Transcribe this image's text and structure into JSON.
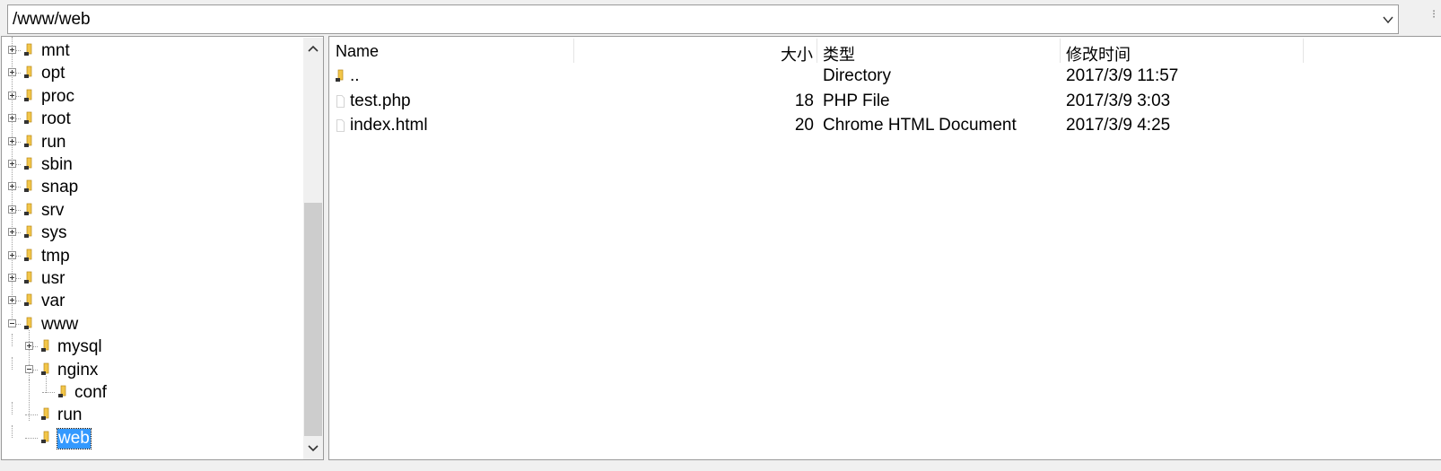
{
  "path_bar": {
    "value": "/www/web",
    "dropdown_icon": "chevron-down-icon"
  },
  "tree": {
    "items": [
      {
        "label": "mnt",
        "level": 0,
        "toggle": "plus"
      },
      {
        "label": "opt",
        "level": 0,
        "toggle": "plus"
      },
      {
        "label": "proc",
        "level": 0,
        "toggle": "plus"
      },
      {
        "label": "root",
        "level": 0,
        "toggle": "plus"
      },
      {
        "label": "run",
        "level": 0,
        "toggle": "plus"
      },
      {
        "label": "sbin",
        "level": 0,
        "toggle": "plus"
      },
      {
        "label": "snap",
        "level": 0,
        "toggle": "plus"
      },
      {
        "label": "srv",
        "level": 0,
        "toggle": "plus"
      },
      {
        "label": "sys",
        "level": 0,
        "toggle": "plus"
      },
      {
        "label": "tmp",
        "level": 0,
        "toggle": "plus"
      },
      {
        "label": "usr",
        "level": 0,
        "toggle": "plus"
      },
      {
        "label": "var",
        "level": 0,
        "toggle": "plus"
      },
      {
        "label": "www",
        "level": 0,
        "toggle": "minus"
      },
      {
        "label": "mysql",
        "level": 1,
        "toggle": "plus"
      },
      {
        "label": "nginx",
        "level": 1,
        "toggle": "minus"
      },
      {
        "label": "conf",
        "level": 2,
        "toggle": "none"
      },
      {
        "label": "run",
        "level": 1,
        "toggle": "none"
      },
      {
        "label": "web",
        "level": 1,
        "toggle": "none",
        "selected": true
      }
    ],
    "selected_color": "#3399ff",
    "folder_color": "#f2c649"
  },
  "file_list": {
    "columns": {
      "name": "Name",
      "size": "大小",
      "type": "类型",
      "modified": "修改时间"
    },
    "rows": [
      {
        "icon": "folder-icon",
        "name": "..",
        "size": "",
        "type": "Directory",
        "modified": "2017/3/9 11:57"
      },
      {
        "icon": "file-icon",
        "name": "test.php",
        "size": "18",
        "type": "PHP File",
        "modified": "2017/3/9 3:03"
      },
      {
        "icon": "file-icon",
        "name": "index.html",
        "size": "20",
        "type": "Chrome HTML Document",
        "modified": "2017/3/9 4:25"
      }
    ]
  }
}
